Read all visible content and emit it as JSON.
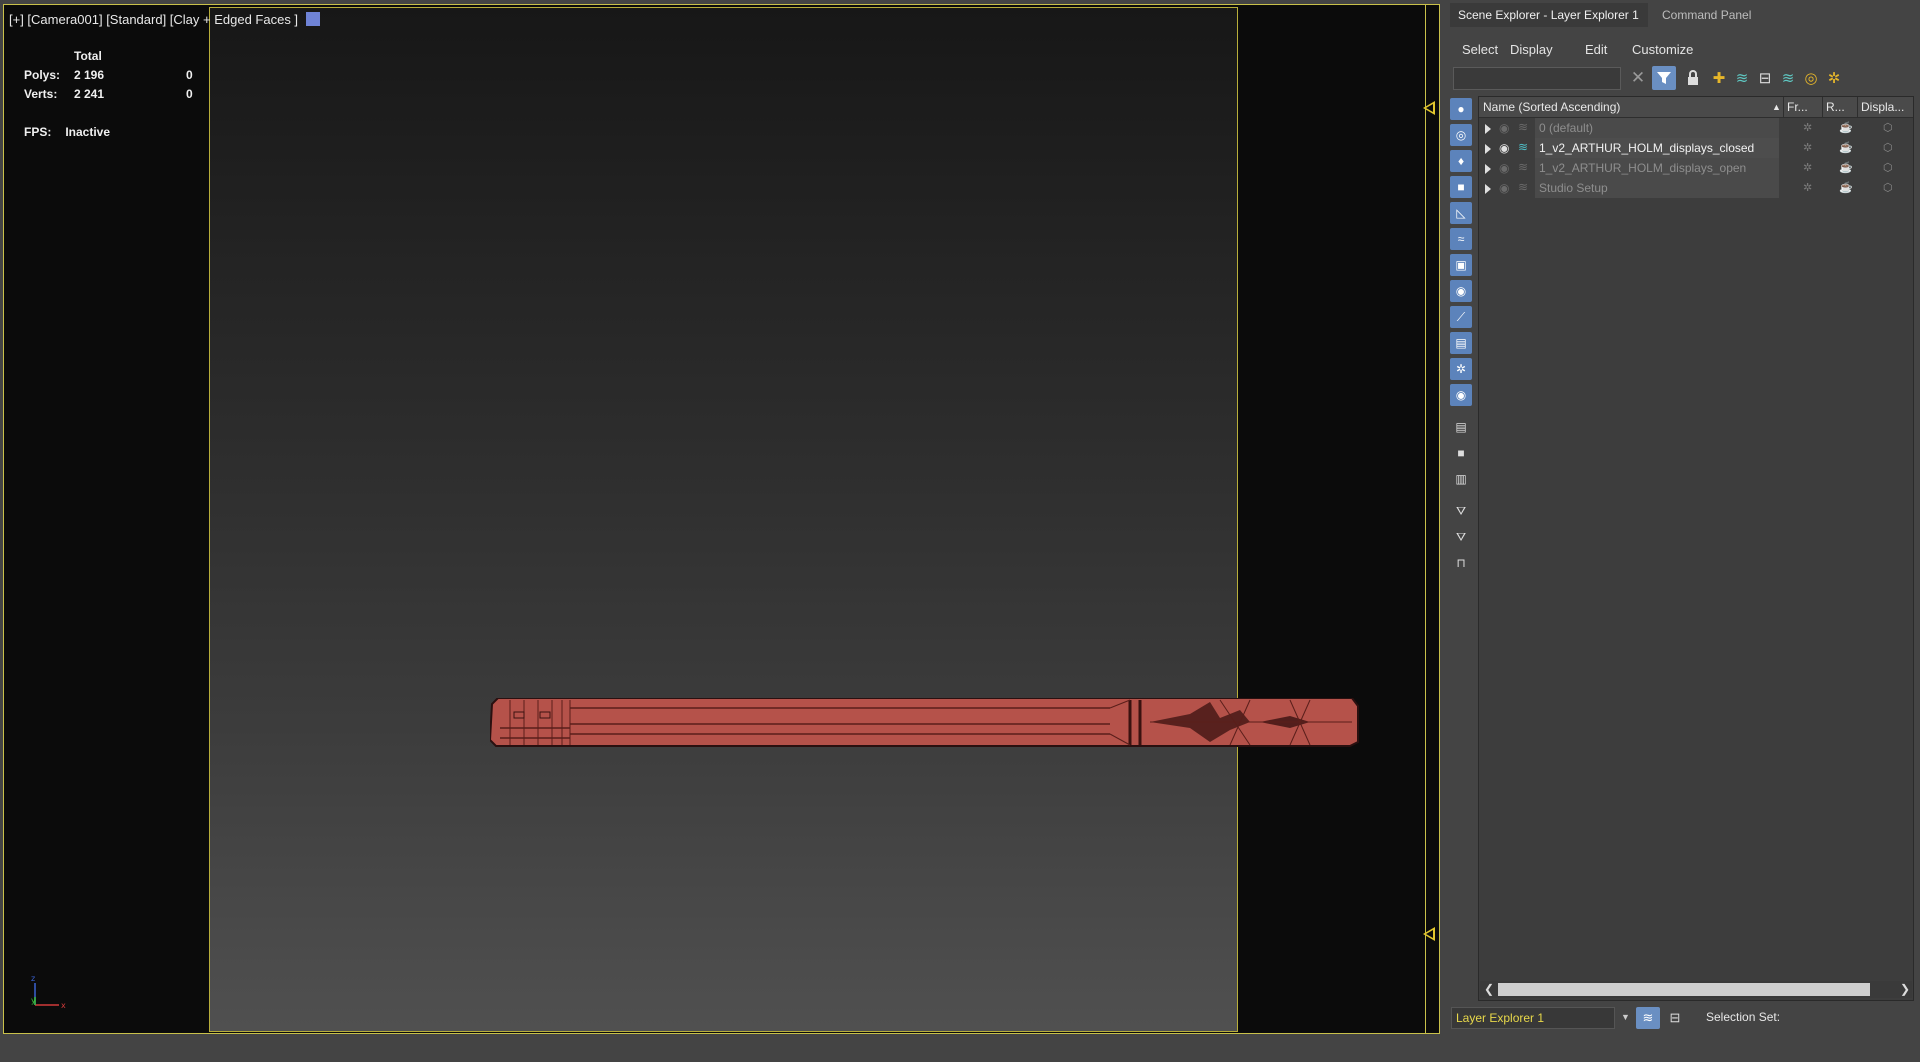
{
  "viewport": {
    "label": "[+] [Camera001] [Standard] [Clay + Edged Faces ]",
    "stats": {
      "header": "Total",
      "polys_label": "Polys:",
      "polys_value": "2 196",
      "polys_selected": "0",
      "verts_label": "Verts:",
      "verts_value": "2 241",
      "verts_selected": "0",
      "fps_label": "FPS:",
      "fps_value": "Inactive"
    },
    "axis": {
      "z": "z",
      "y": "y",
      "x": "x"
    }
  },
  "panel": {
    "tabs": [
      "Scene Explorer - Layer Explorer 1",
      "Command Panel"
    ],
    "menu": [
      "Select",
      "Display",
      "Edit",
      "Customize"
    ],
    "search_value": "",
    "tree": {
      "columns": [
        "Name (Sorted Ascending)",
        "Fr...",
        "R...",
        "Displa..."
      ],
      "rows": [
        {
          "name": "0 (default)",
          "active": false
        },
        {
          "name": "1_v2_ARTHUR_HOLM_displays_closed",
          "active": true
        },
        {
          "name": "1_v2_ARTHUR_HOLM_displays_open",
          "active": false
        },
        {
          "name": "Studio Setup",
          "active": false
        }
      ]
    },
    "bottom": {
      "explorer_name": "Layer Explorer 1",
      "selection_set_label": "Selection Set:"
    }
  },
  "colors": {
    "viewport_border": "#c9c14a",
    "model_fill": "#b5524a",
    "accent_blue": "#6a8fc2"
  }
}
